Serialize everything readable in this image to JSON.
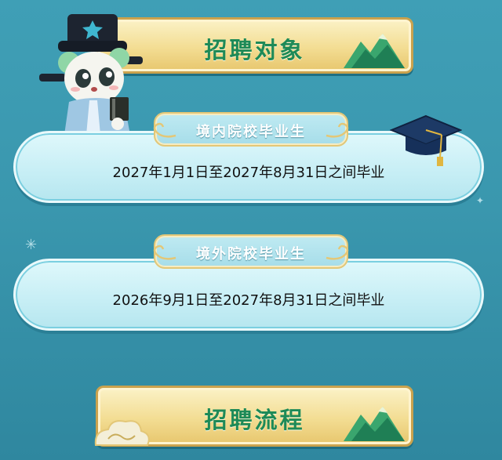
{
  "section1": {
    "title": "招聘对象"
  },
  "domestic": {
    "label": "境内院校毕业生",
    "date_range": "2027年1月1日至2027年8月31日之间毕业"
  },
  "overseas": {
    "label": "境外院校毕业生",
    "date_range": "2026年9月1日至2027年8月31日之间毕业"
  },
  "section2": {
    "title": "招聘流程"
  },
  "icons": {
    "mascot": "scholar-panda-mascot-icon",
    "cap": "graduation-cap-icon",
    "sparkle": "sparkle-icon",
    "hill": "mountain-decoration-icon",
    "cloud": "cloud-swirl-icon"
  },
  "colors": {
    "background": "#3a97ae",
    "banner_gold": "#f3dd93",
    "title_green": "#1e8a57",
    "panel_cyan": "#c6eef5"
  }
}
